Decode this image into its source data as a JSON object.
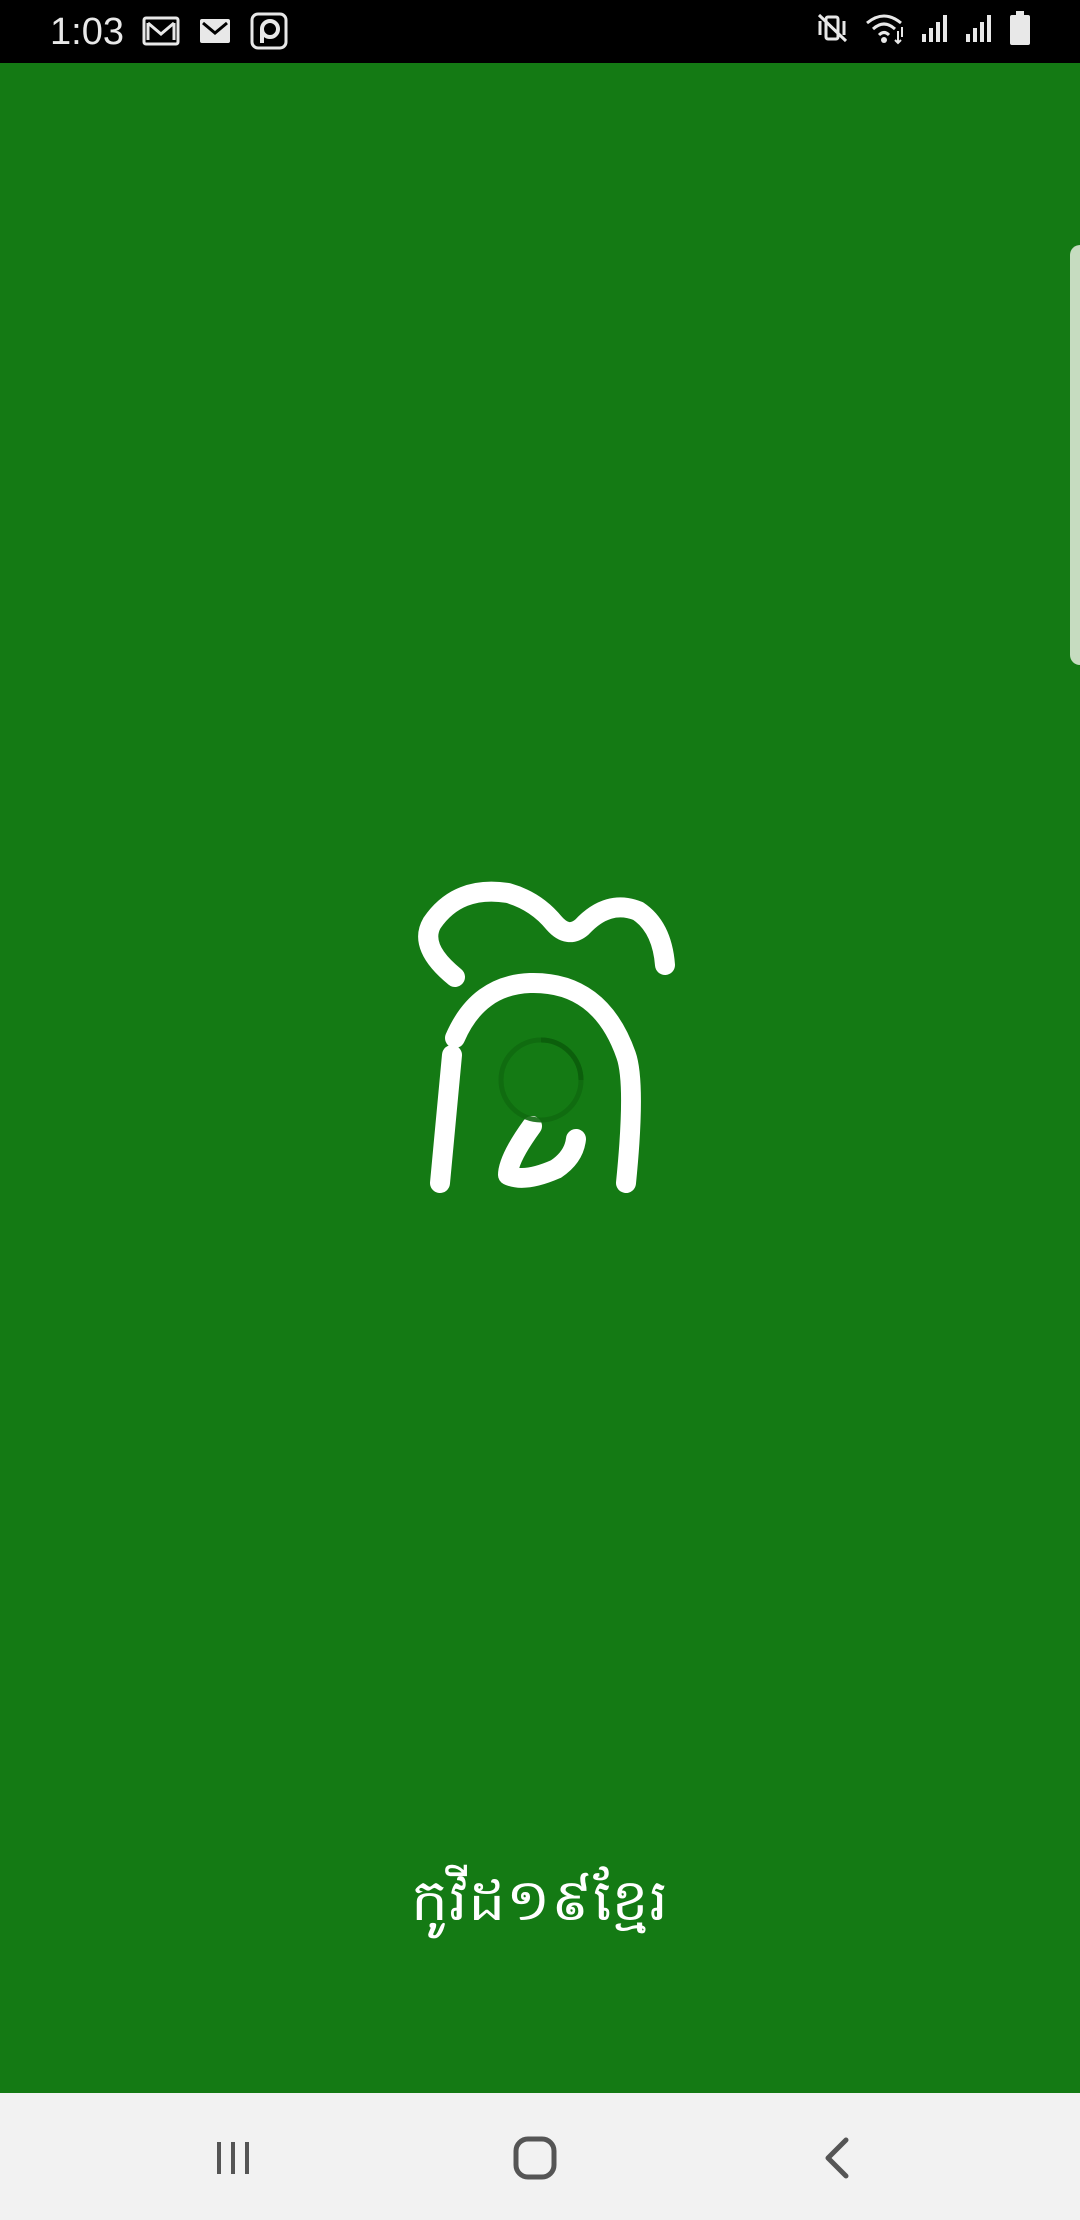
{
  "status_bar": {
    "time": "1:03",
    "left_icons": [
      "gmail-icon",
      "gmail-icon",
      "app-notification-icon"
    ],
    "right_icons": [
      "vibrate-icon",
      "wifi-icon",
      "signal-icon",
      "signal-icon",
      "battery-icon"
    ]
  },
  "app": {
    "name": "កូវីដ១៩ខ្មែរ",
    "background_color": "#147a14",
    "logo_icon": "khmer-letter-logo-icon",
    "loading": true
  },
  "nav_bar": {
    "buttons": [
      "recents-icon",
      "home-icon",
      "back-icon"
    ]
  }
}
